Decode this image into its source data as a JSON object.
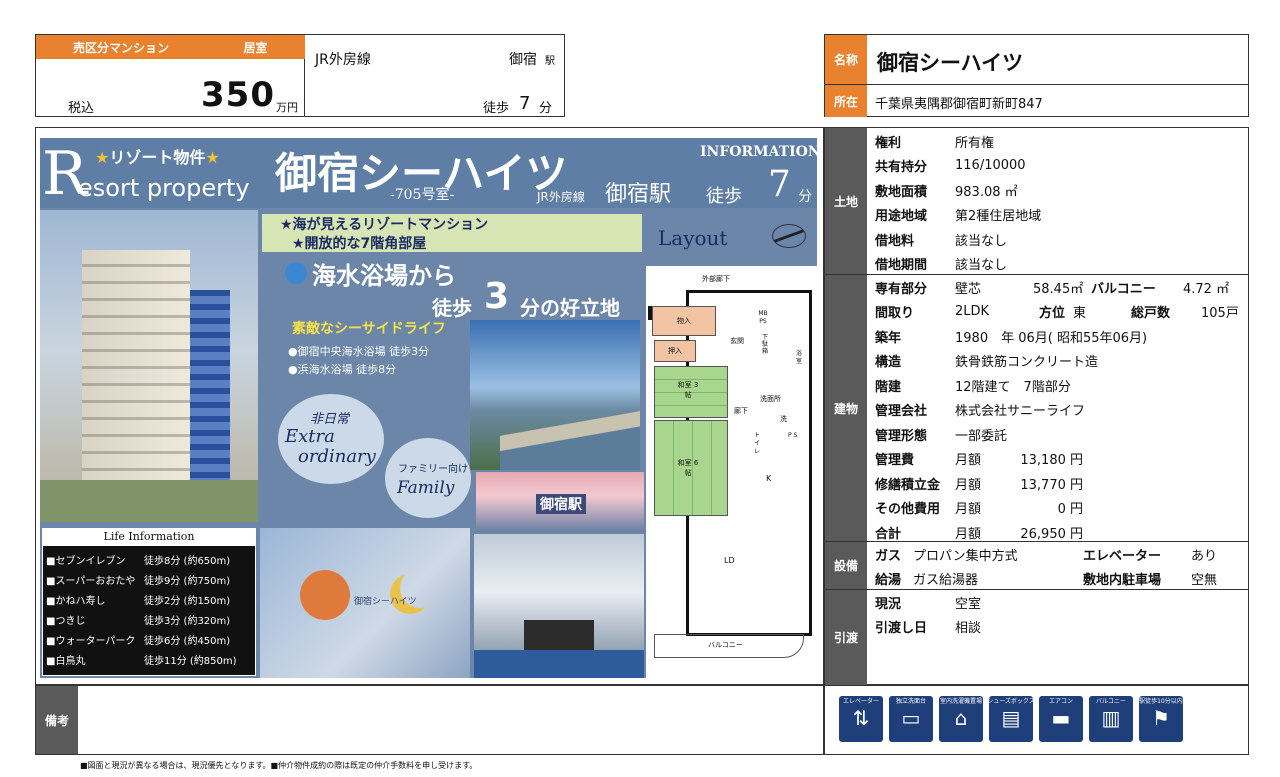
{
  "header": {
    "category": "売区分マンション",
    "type": "居室",
    "tax_label": "税込",
    "price": "350",
    "price_unit": "万円",
    "line": "JR外房線",
    "station": "御宿",
    "station_suffix": "駅",
    "walk_label": "徒歩",
    "walk_minutes": "7",
    "walk_unit": "分",
    "name_label": "名称",
    "name": "御宿シーハイツ",
    "address_label": "所在",
    "address": "千葉県夷隅郡御宿町新町847"
  },
  "poster": {
    "tag": "リゾート物件",
    "resort_r": "R",
    "resort_rest": "esort property",
    "title": "御宿シーハイツ",
    "room": "-705号室-",
    "info": "INFORMATION",
    "access_line": "JR外房線",
    "access_station": "御宿駅",
    "access_walk": "徒歩",
    "access_min": "7",
    "access_unit": "分",
    "banner1": "★海が見えるリゾートマンション",
    "banner2": "★開放的な7階角部屋",
    "layout": "Layout",
    "beach1": "海水浴場から",
    "beach2_a": "徒歩",
    "beach2_num": "3",
    "beach2_b": "分の好立地",
    "seaside": "素敵なシーサイドライフ",
    "beach_list": [
      "●御宿中央海水浴場 徒歩3分",
      "●浜海水浴場 徒歩8分"
    ],
    "bubble1_jp": "非日常",
    "bubble1_en1": "Extra",
    "bubble1_en2": "ordinary",
    "bubble2_jp": "ファミリー向け",
    "bubble2_en": "Family",
    "life_title": "Life Information",
    "life": [
      {
        "name": "■セブンイレブン",
        "dist": "徒歩8分 (約650m)"
      },
      {
        "name": "■スーパーおおたや",
        "dist": "徒歩9分 (約750m)"
      },
      {
        "name": "■かねハ寿し",
        "dist": "徒歩2分 (約150m)"
      },
      {
        "name": "■つきじ",
        "dist": "徒歩3分 (約320m)"
      },
      {
        "name": "■ウォーターパーク",
        "dist": "徒歩6分 (約450m)"
      },
      {
        "name": "■白鳥丸",
        "dist": "徒歩11分 (約850m)"
      }
    ],
    "station_sign": "御宿駅",
    "wall_sign": "御宿シーハイツ"
  },
  "floorplan": {
    "corridor": "外部廊下",
    "storage": "物入",
    "mbps": "MB PS",
    "oshiire": "押入",
    "genkan": "玄関",
    "shoe": "下駄箱",
    "bath": "浴室",
    "washing": "物入",
    "room1": "和室 3帖",
    "room2": "和室 6帖",
    "hall": "廊下",
    "senmen": "洗面所",
    "wash": "洗",
    "toilet": "トイレ",
    "ps": "P S",
    "kitchen": "K",
    "ld": "LD",
    "balcony": "バルコニー"
  },
  "land": {
    "label": "土地",
    "rows": [
      {
        "k": "権利",
        "v": "所有権"
      },
      {
        "k": "共有持分",
        "v": "116/10000"
      },
      {
        "k": "敷地面積",
        "v": "983.08 ㎡"
      },
      {
        "k": "用途地域",
        "v": "第2種住居地域"
      },
      {
        "k": "借地料",
        "v": "該当なし"
      },
      {
        "k": "借地期間",
        "v": "該当なし"
      }
    ]
  },
  "building": {
    "label": "建物",
    "private_k": "専有部分",
    "private_v1": "壁芯",
    "private_v2": "58.45㎡",
    "balcony_k": "バルコニー",
    "balcony_v": "4.72 ㎡",
    "layout_k": "間取り",
    "layout_v": "2LDK",
    "dir_k": "方位",
    "dir_v": "東",
    "units_k": "総戸数",
    "units_v": "105戸",
    "built_k": "築年",
    "built_v": "1980　年 06月( 昭和55年06月)",
    "struct_k": "構造",
    "struct_v": "鉄骨鉄筋コンクリート造",
    "floor_k": "階建",
    "floor_v": "12階建て　7階部分",
    "mgmt_k": "管理会社",
    "mgmt_v": "株式会社サニーライフ",
    "form_k": "管理形態",
    "form_v": "一部委託",
    "fees": [
      {
        "k": "管理費",
        "p": "月額",
        "v": "13,180 円"
      },
      {
        "k": "修繕積立金",
        "p": "月額",
        "v": "13,770 円"
      },
      {
        "k": "その他費用",
        "p": "月額",
        "v": "0 円"
      },
      {
        "k": "合計",
        "p": "月額",
        "v": "26,950 円"
      }
    ]
  },
  "equipment": {
    "label": "設備",
    "gas_k": "ガス",
    "gas_v": "プロパン集中方式",
    "elev_k": "エレベーター",
    "elev_v": "あり",
    "hot_k": "給湯",
    "hot_v": "ガス給湯器",
    "park_k": "敷地内駐車場",
    "park_v": "空無"
  },
  "handover": {
    "label": "引渡",
    "status_k": "現況",
    "status_v": "空室",
    "date_k": "引渡し日",
    "date_v": "相談"
  },
  "remarks": {
    "label": "備考"
  },
  "icons": [
    {
      "cap": "エレベーター",
      "sym": "⇅"
    },
    {
      "cap": "独立洗面台",
      "sym": "▭"
    },
    {
      "cap": "室内洗濯機置場",
      "sym": "⌂"
    },
    {
      "cap": "シューズボックス",
      "sym": "▤"
    },
    {
      "cap": "エアコン",
      "sym": "▬"
    },
    {
      "cap": "バルコニー",
      "sym": "▥"
    },
    {
      "cap": "駅徒歩10分以内",
      "sym": "⚑"
    }
  ],
  "footer": "■図面と現況が異なる場合は、現況優先となります。■仲介物件成約の際は既定の仲介手数料を申し受けます。"
}
